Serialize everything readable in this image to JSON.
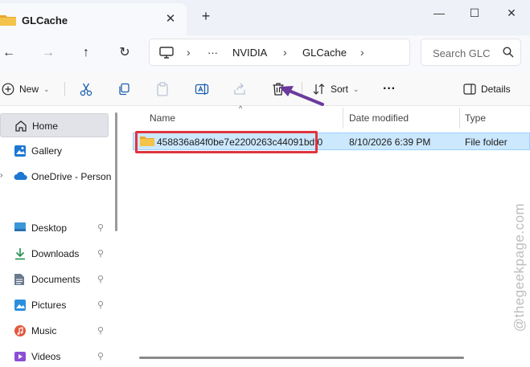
{
  "tab": {
    "title": "GLCache",
    "close": "✕",
    "new_tab": "+"
  },
  "window": {
    "minimize": "—",
    "maximize": "☐",
    "close": "✕"
  },
  "nav": {
    "back": "←",
    "forward": "→",
    "up": "↑",
    "refresh": "↻"
  },
  "address": {
    "sep": "›",
    "ellipsis": "···",
    "crumbs": [
      "NVIDIA",
      "GLCache"
    ]
  },
  "search": {
    "placeholder": "Search GLC"
  },
  "commands": {
    "new_label": "New",
    "sort_label": "Sort",
    "more_label": "···",
    "details_label": "Details"
  },
  "sidebar": {
    "items": [
      {
        "label": "Home"
      },
      {
        "label": "Gallery"
      },
      {
        "label": "OneDrive - Person"
      },
      {
        "label": "Desktop"
      },
      {
        "label": "Downloads"
      },
      {
        "label": "Documents"
      },
      {
        "label": "Pictures"
      },
      {
        "label": "Music"
      },
      {
        "label": "Videos"
      }
    ],
    "pin": "📌",
    "expander": "›"
  },
  "columns": {
    "name": "Name",
    "date": "Date modified",
    "type": "Type",
    "sort_indicator": "^"
  },
  "files": [
    {
      "name": "458836a84f0be7e2200263c44091bdf0",
      "date": "8/10/2026 6:39 PM",
      "type": "File folder"
    }
  ],
  "watermark": "@thegeekpage.com",
  "colors": {
    "accent": "#0067c0",
    "highlight": "#e0343f",
    "annotation": "#6a3a9c",
    "selection": "#cce8ff",
    "folder": "#f4c34a"
  }
}
